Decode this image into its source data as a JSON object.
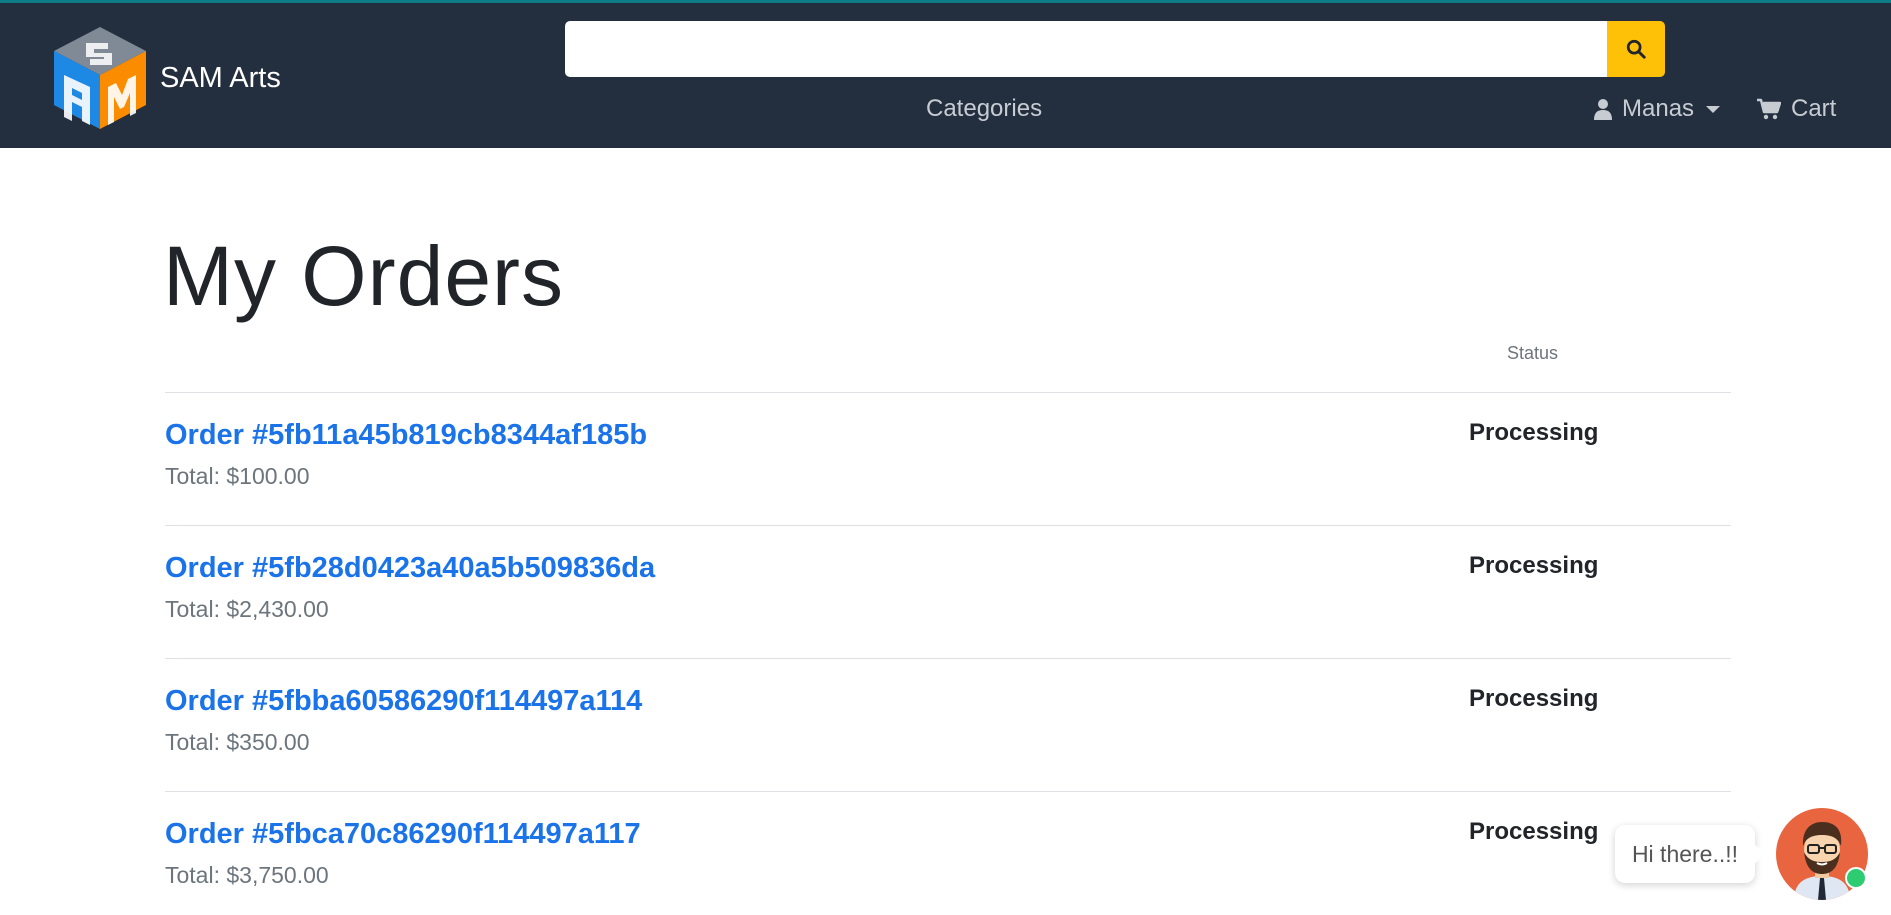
{
  "header": {
    "brand_name": "SAM Arts",
    "logo_letters": "SAM",
    "search": {
      "value": "",
      "placeholder": ""
    },
    "search_icon": "search-icon",
    "nav": {
      "categories": "Categories",
      "user": "Manas",
      "cart": "Cart"
    }
  },
  "main": {
    "title": "My Orders",
    "status_header": "Status",
    "orders": [
      {
        "link": "Order #5fb11a45b819cb8344af185b",
        "total": "Total: $100.00",
        "status": "Processing"
      },
      {
        "link": "Order #5fb28d0423a40a5b509836da",
        "total": "Total: $2,430.00",
        "status": "Processing"
      },
      {
        "link": "Order #5fbba60586290f114497a114",
        "total": "Total: $350.00",
        "status": "Processing"
      },
      {
        "link": "Order #5fbca70c86290f114497a117",
        "total": "Total: $3,750.00",
        "status": "Processing"
      }
    ]
  },
  "chat": {
    "greeting": "Hi there..!!"
  },
  "colors": {
    "header_bg": "#232f3e",
    "accent_search": "#ffc107",
    "link": "#1a73e8",
    "logo_blue": "#1e88e5",
    "logo_orange": "#fb8c00",
    "logo_grey": "#7f8a96",
    "chat_avatar_bg": "#e8653f",
    "online": "#2ecc71"
  }
}
